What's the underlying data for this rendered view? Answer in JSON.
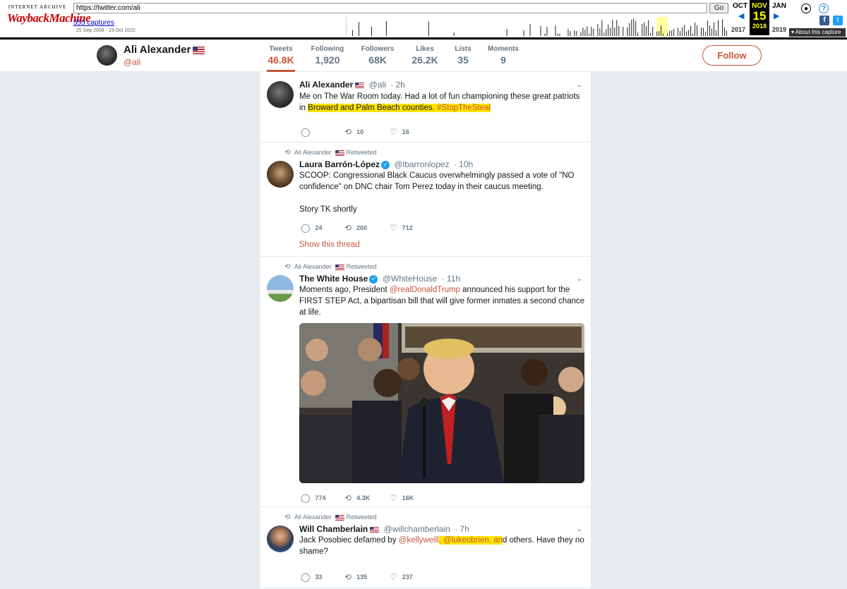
{
  "wayback": {
    "logo_top": "INTERNET ARCHIVE",
    "logo_main": "WaybackMachine",
    "url": "https://twitter.com/ali",
    "go_label": "Go",
    "captures_link": "555 captures",
    "date_range": "25 Sep 2008 - 23 Oct 2022",
    "prev_month": "OCT",
    "cur_month": "NOV",
    "next_month": "JAN",
    "cur_day": "15",
    "prev_year": "2017",
    "cur_year": "2018",
    "next_year": "2019",
    "about_label": "▾ About this capture",
    "icons": [
      "account-icon",
      "help-icon",
      "facebook-icon",
      "twitter-icon"
    ],
    "accent": "#ffff00"
  },
  "profile": {
    "name": "Ali Alexander",
    "handle": "@ali",
    "follow_label": "Follow",
    "stats": [
      {
        "label": "Tweets",
        "value": "46.8K",
        "active": true
      },
      {
        "label": "Following",
        "value": "1,920",
        "active": false
      },
      {
        "label": "Followers",
        "value": "68K",
        "active": false
      },
      {
        "label": "Likes",
        "value": "26.2K",
        "active": false
      },
      {
        "label": "Lists",
        "value": "35",
        "active": false
      },
      {
        "label": "Moments",
        "value": "9",
        "active": false
      }
    ],
    "accent": "#c8553d"
  },
  "tweets": [
    {
      "name": "Ali Alexander",
      "handle": "@ali",
      "time": "· 2h",
      "text_plain": "Me on The War Room today. Had a lot of fun championing these great patriots in",
      "text_hl": "Broward and Palm Beach counties.",
      "text_hashtag": "#StopTheSteal",
      "replies": "",
      "retweets": "10",
      "likes": "16"
    },
    {
      "retweeted_by": "Ali Alexander",
      "retweeted_label": "Retweeted",
      "name": "Laura Barrón-López",
      "handle": "@lbarronlopez",
      "time": "· 10h",
      "text_1": "SCOOP: Congressional Black Caucus overwhelmingly passed a vote of \"NO confidence\" on DNC chair Tom Perez today in their caucus meeting.",
      "text_2": "Story TK shortly",
      "replies": "24",
      "retweets": "260",
      "likes": "712",
      "show_thread": "Show this thread"
    },
    {
      "retweeted_by": "Ali Alexander",
      "retweeted_label": "Retweeted",
      "name": "The White House",
      "handle": "@WhiteHouse",
      "time": "· 11h",
      "text_a": "Moments ago, President",
      "mention": "@realDonaldTrump",
      "text_b": "announced his support for the FIRST STEP Act, a bipartisan bill that will give former inmates a second chance at life.",
      "replies": "774",
      "retweets": "4.3K",
      "likes": "16K"
    },
    {
      "retweeted_by": "Ali Alexander",
      "retweeted_label": "Retweeted",
      "name": "Will Chamberlain",
      "handle": "@willchamberlain",
      "time": "· 7h",
      "text_a": "Jack Posobiec defamed by",
      "mention_1": "@kellyweill",
      "mention_2": ", @lukeobrien, an",
      "text_b": "d others. Have they no shame?",
      "replies": "33",
      "retweets": "135",
      "likes": "237"
    }
  ]
}
